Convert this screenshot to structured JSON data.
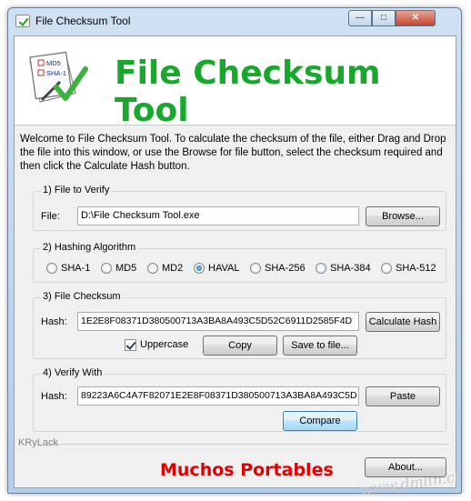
{
  "window": {
    "title": "File Checksum Tool",
    "controls": {
      "minimize": "—",
      "maximize": "□",
      "close": "✕"
    }
  },
  "banner": {
    "title": "File Checksum Tool",
    "logo_lines": [
      "MD5",
      "SHA-1"
    ]
  },
  "intro": "Welcome to File Checksum Tool. To calculate the checksum of the file, either Drag and Drop the file into this window, or use the Browse for file button, select the checksum required and then click the Calculate Hash button.",
  "file_group": {
    "label": "1) File to Verify",
    "field_label": "File:",
    "value": "D:\\File Checksum Tool.exe",
    "browse": "Browse..."
  },
  "algo_group": {
    "label": "2) Hashing Algorithm",
    "options": [
      "SHA-1",
      "MD5",
      "MD2",
      "HAVAL",
      "SHA-256",
      "SHA-384",
      "SHA-512"
    ],
    "selected": "HAVAL"
  },
  "checksum_group": {
    "label": "3) File Checksum",
    "field_label": "Hash:",
    "value": "1E2E8F08371D380500713A3BA8A493C5D52C6911D2585F4D",
    "calculate": "Calculate Hash",
    "uppercase_label": "Uppercase",
    "copy": "Copy",
    "save": "Save to file..."
  },
  "verify_group": {
    "label": "4) Verify With",
    "field_label": "Hash:",
    "value": "89223A6C4A7F82071E2E8F08371D380500713A3BA8A493C5D",
    "paste": "Paste",
    "compare": "Compare"
  },
  "footer": {
    "brand": "KRyLack",
    "about": "About...",
    "promo": "Muchos Portables",
    "watermark": "www.dmlin.cl"
  },
  "colors": {
    "banner_title": "#19a82d",
    "promo": "#e00000",
    "window_frame": "#b4cde8"
  }
}
